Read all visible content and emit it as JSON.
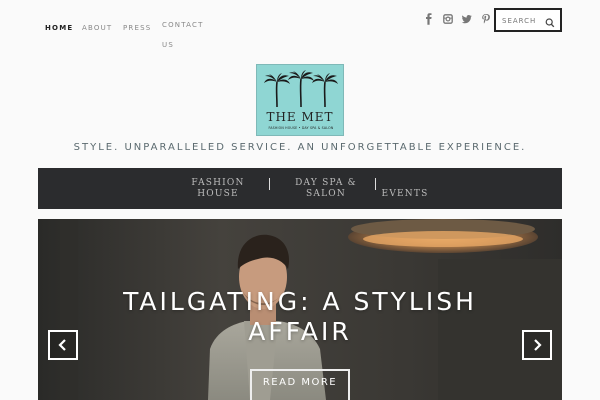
{
  "nav": {
    "items": [
      {
        "label": "HOME"
      },
      {
        "label": "ABOUT"
      },
      {
        "label": "PRESS"
      },
      {
        "label": "CONTACT US"
      }
    ]
  },
  "social": {
    "icons": [
      "facebook-icon",
      "instagram-icon",
      "twitter-icon",
      "pinterest-icon"
    ]
  },
  "search": {
    "placeholder": "SEARCH"
  },
  "logo": {
    "name": "THE MET",
    "subtitle": "FASHION HOUSE • DAY SPA & SALON",
    "background": "#8fd6d3"
  },
  "tagline": "STYLE. UNPARALLELED SERVICE. AN UNFORGETTABLE EXPERIENCE.",
  "menu": {
    "items": [
      {
        "label": "FASHION HOUSE"
      },
      {
        "label": "DAY SPA & SALON"
      },
      {
        "label": "EVENTS"
      }
    ],
    "background": "#2b2c2e"
  },
  "slider": {
    "title": "TAILGATING: A STYLISH AFFAIR",
    "button": "READ MORE"
  }
}
